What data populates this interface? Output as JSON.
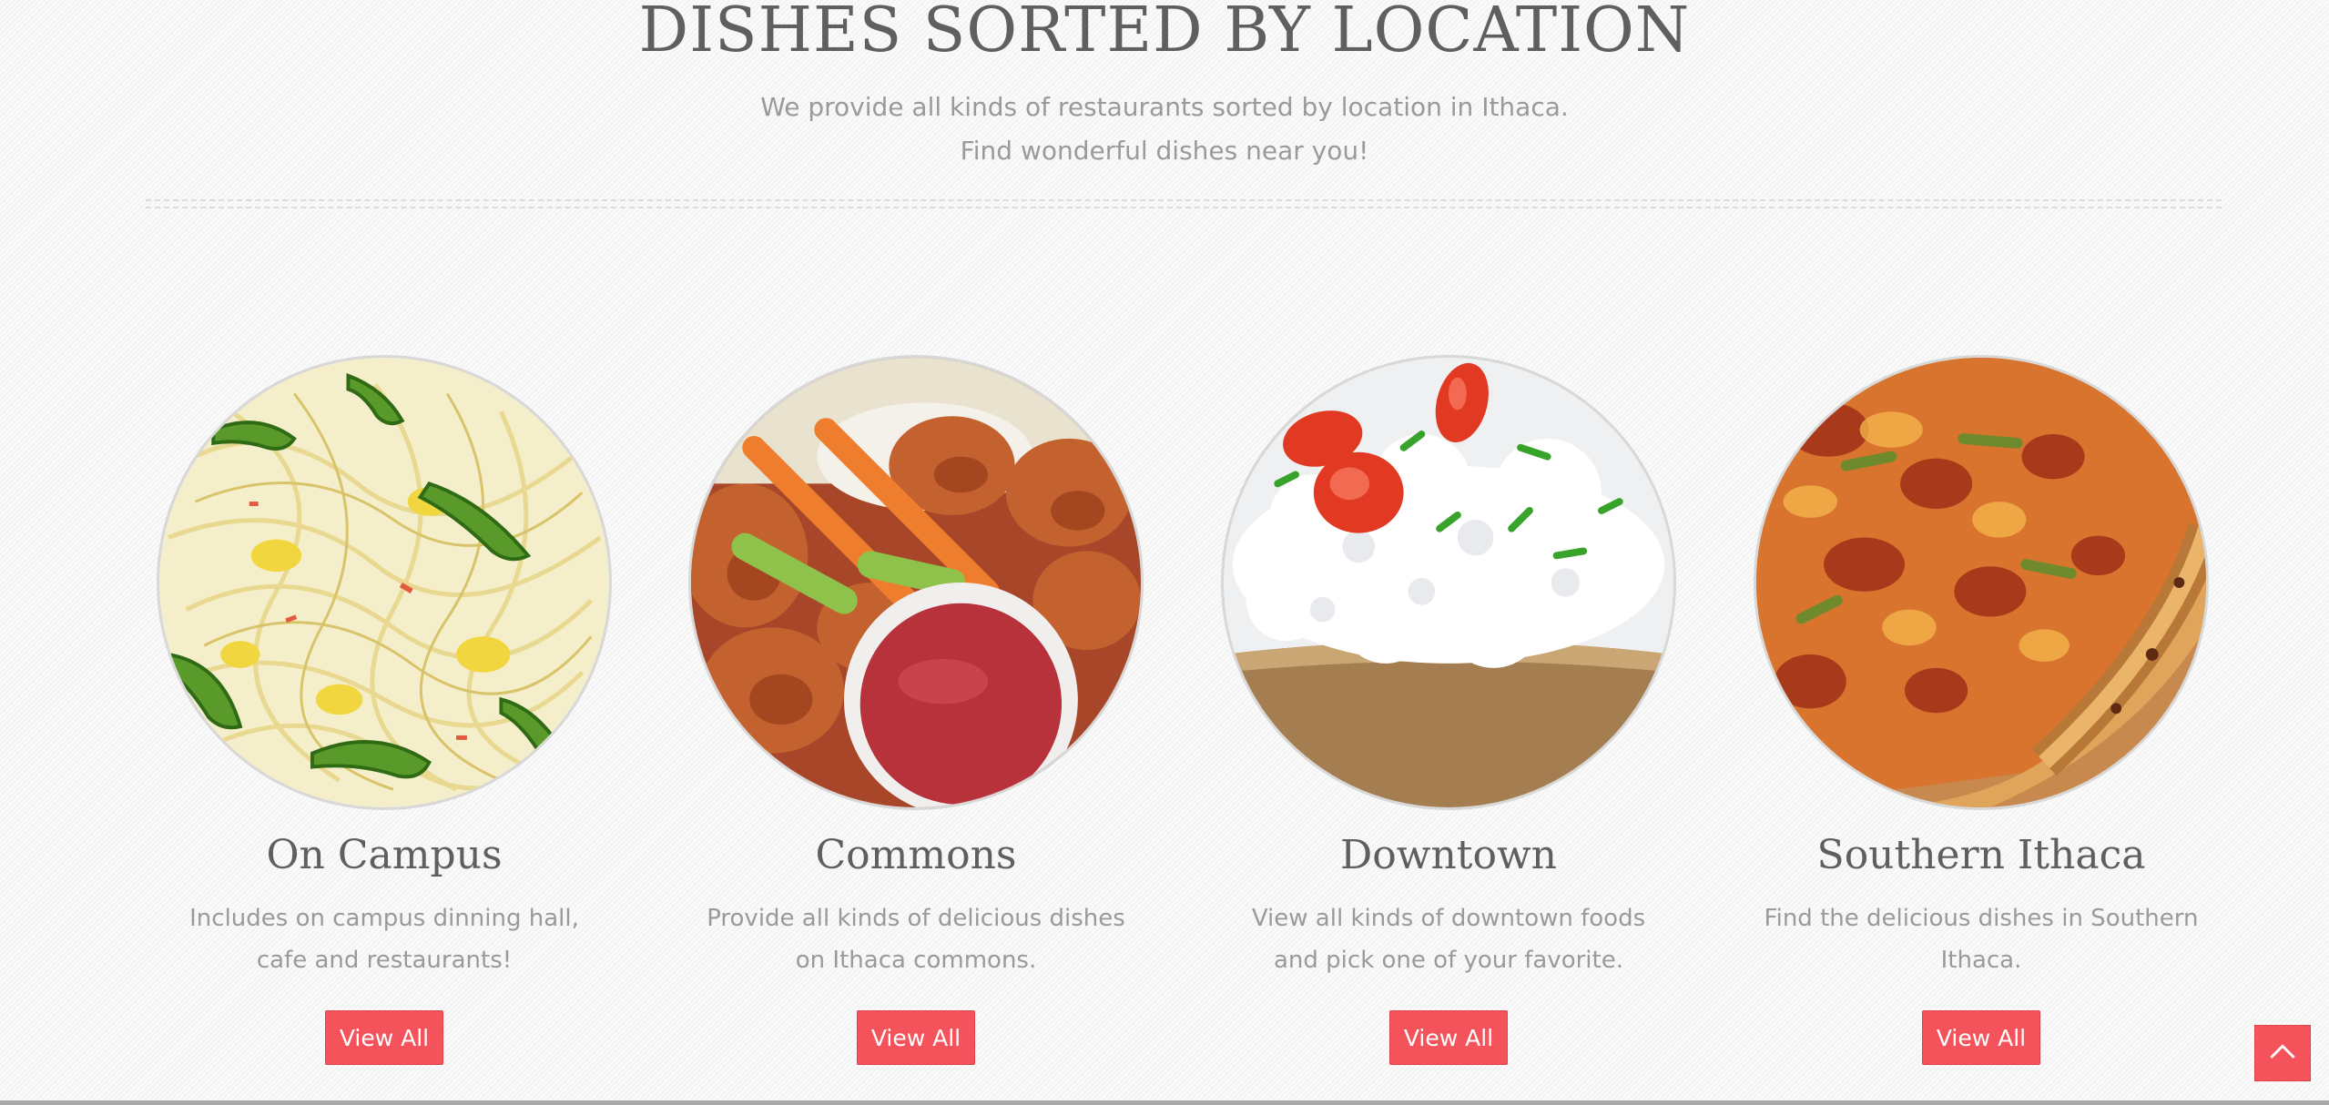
{
  "section": {
    "title": "DISHES SORTED BY LOCATION",
    "subtitle": "We provide all kinds of restaurants sorted by location in Ithaca. Find wonderful dishes near you!"
  },
  "locations": [
    {
      "title": "On Campus",
      "description": "Includes on campus dinning hall, cafe and restaurants!",
      "button_label": "View All",
      "image": "noodles-photo"
    },
    {
      "title": "Commons",
      "description": "Provide all kinds of delicious dishes on Ithaca commons.",
      "button_label": "View All",
      "image": "wings-photo"
    },
    {
      "title": "Downtown",
      "description": "View all kinds of downtown foods and pick one of your favorite.",
      "button_label": "View All",
      "image": "bread-cheese-photo"
    },
    {
      "title": "Southern Ithaca",
      "description": "Find the delicious dishes in Southern Ithaca.",
      "button_label": "View All",
      "image": "pizza-photo"
    }
  ],
  "scroll_top": {
    "icon": "chevron-up-icon"
  },
  "colors": {
    "accent": "#f5535b",
    "heading": "#5f5f5f",
    "body_text": "#9a9a9a",
    "background": "#f6f6f6"
  }
}
